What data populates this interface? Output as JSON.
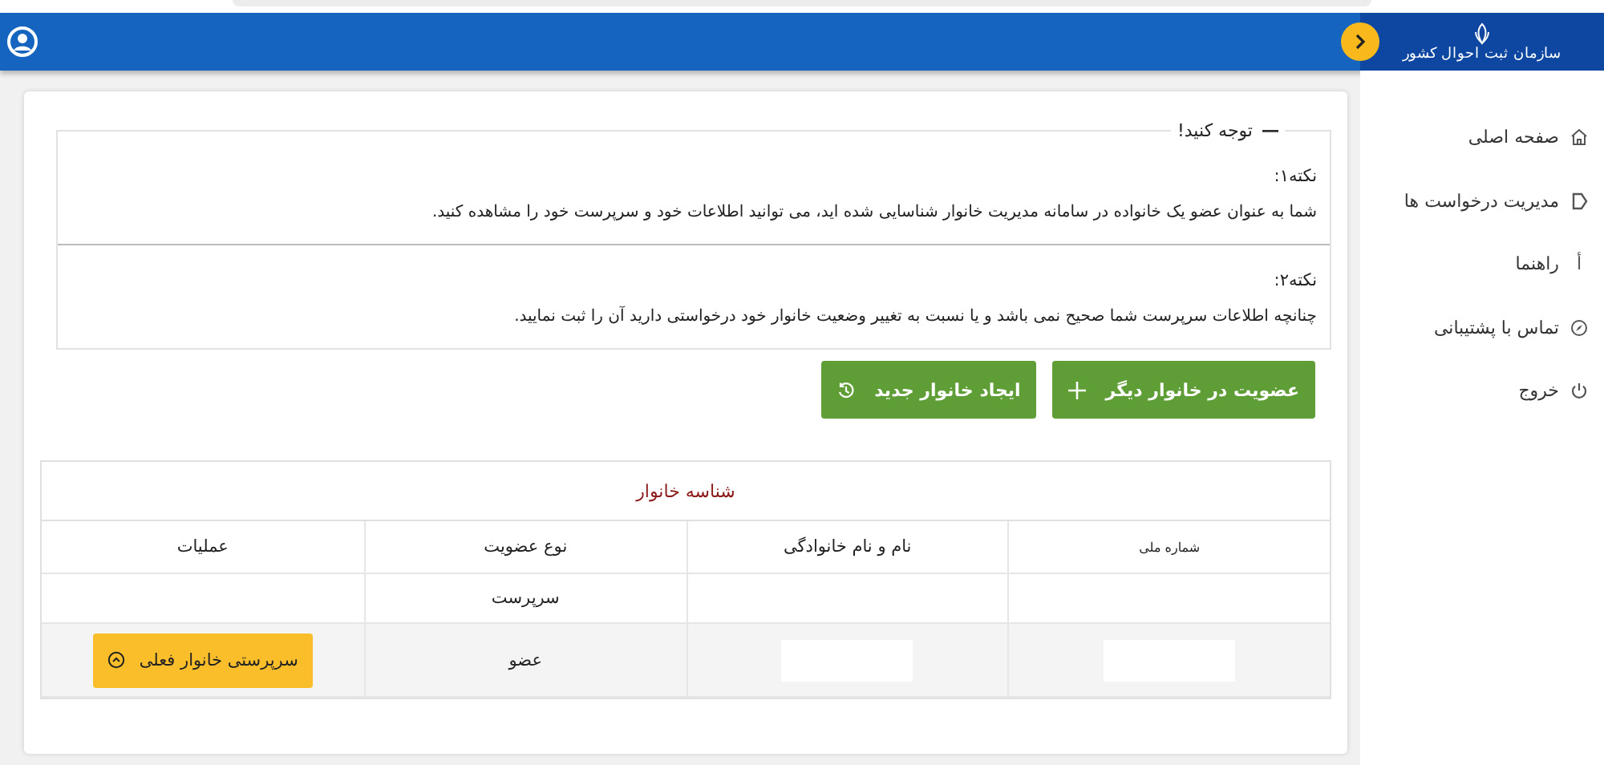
{
  "header": {
    "logo_text": "سازمان ثبت احوال کشور"
  },
  "sidebar": {
    "items": [
      {
        "label": "صفحه اصلی",
        "kind": "home"
      },
      {
        "label": "مدیریت درخواست ها",
        "kind": "requests"
      },
      {
        "label": "راهنما",
        "kind": "guide",
        "icon_text": "أ"
      },
      {
        "label": "تماس با پشتیبانی",
        "kind": "support"
      },
      {
        "label": "خروج",
        "kind": "logout"
      }
    ]
  },
  "notice": {
    "legend": "توجه کنید!",
    "notes": [
      {
        "title": "نکته۱:",
        "text": "شما به عنوان عضو یک خانواده در سامانه مدیریت خانوار شناسایی شده اید، می توانید اطلاعات خود و سرپرست خود را مشاهده کنید."
      },
      {
        "title": "نکته۲:",
        "text": "چنانچه اطلاعات سرپرست شما صحیح نمی باشد و یا نسبت به تغییر وضعیت خانوار خود درخواستی دارید آن را ثبت نمایید."
      }
    ]
  },
  "actions": [
    {
      "label": "عضویت در خانوار دیگر",
      "kind": "plus"
    },
    {
      "label": "ایجاد خانوار جدید",
      "kind": "history"
    }
  ],
  "table": {
    "title": "شناسه خانوار",
    "columns": [
      "شماره ملی",
      "نام و نام خانوادگی",
      "نوع عضویت",
      "عملیات"
    ],
    "rows": [
      {
        "cells": [
          {
            "kind": "empty"
          },
          {
            "kind": "empty"
          },
          {
            "kind": "text",
            "text": "سرپرست"
          },
          {
            "kind": "empty"
          }
        ]
      },
      {
        "cells": [
          {
            "kind": "masked"
          },
          {
            "kind": "masked"
          },
          {
            "kind": "text",
            "text": "عضو"
          },
          {
            "kind": "button",
            "text": "سرپرستی خانوار فعلی"
          }
        ]
      }
    ]
  }
}
